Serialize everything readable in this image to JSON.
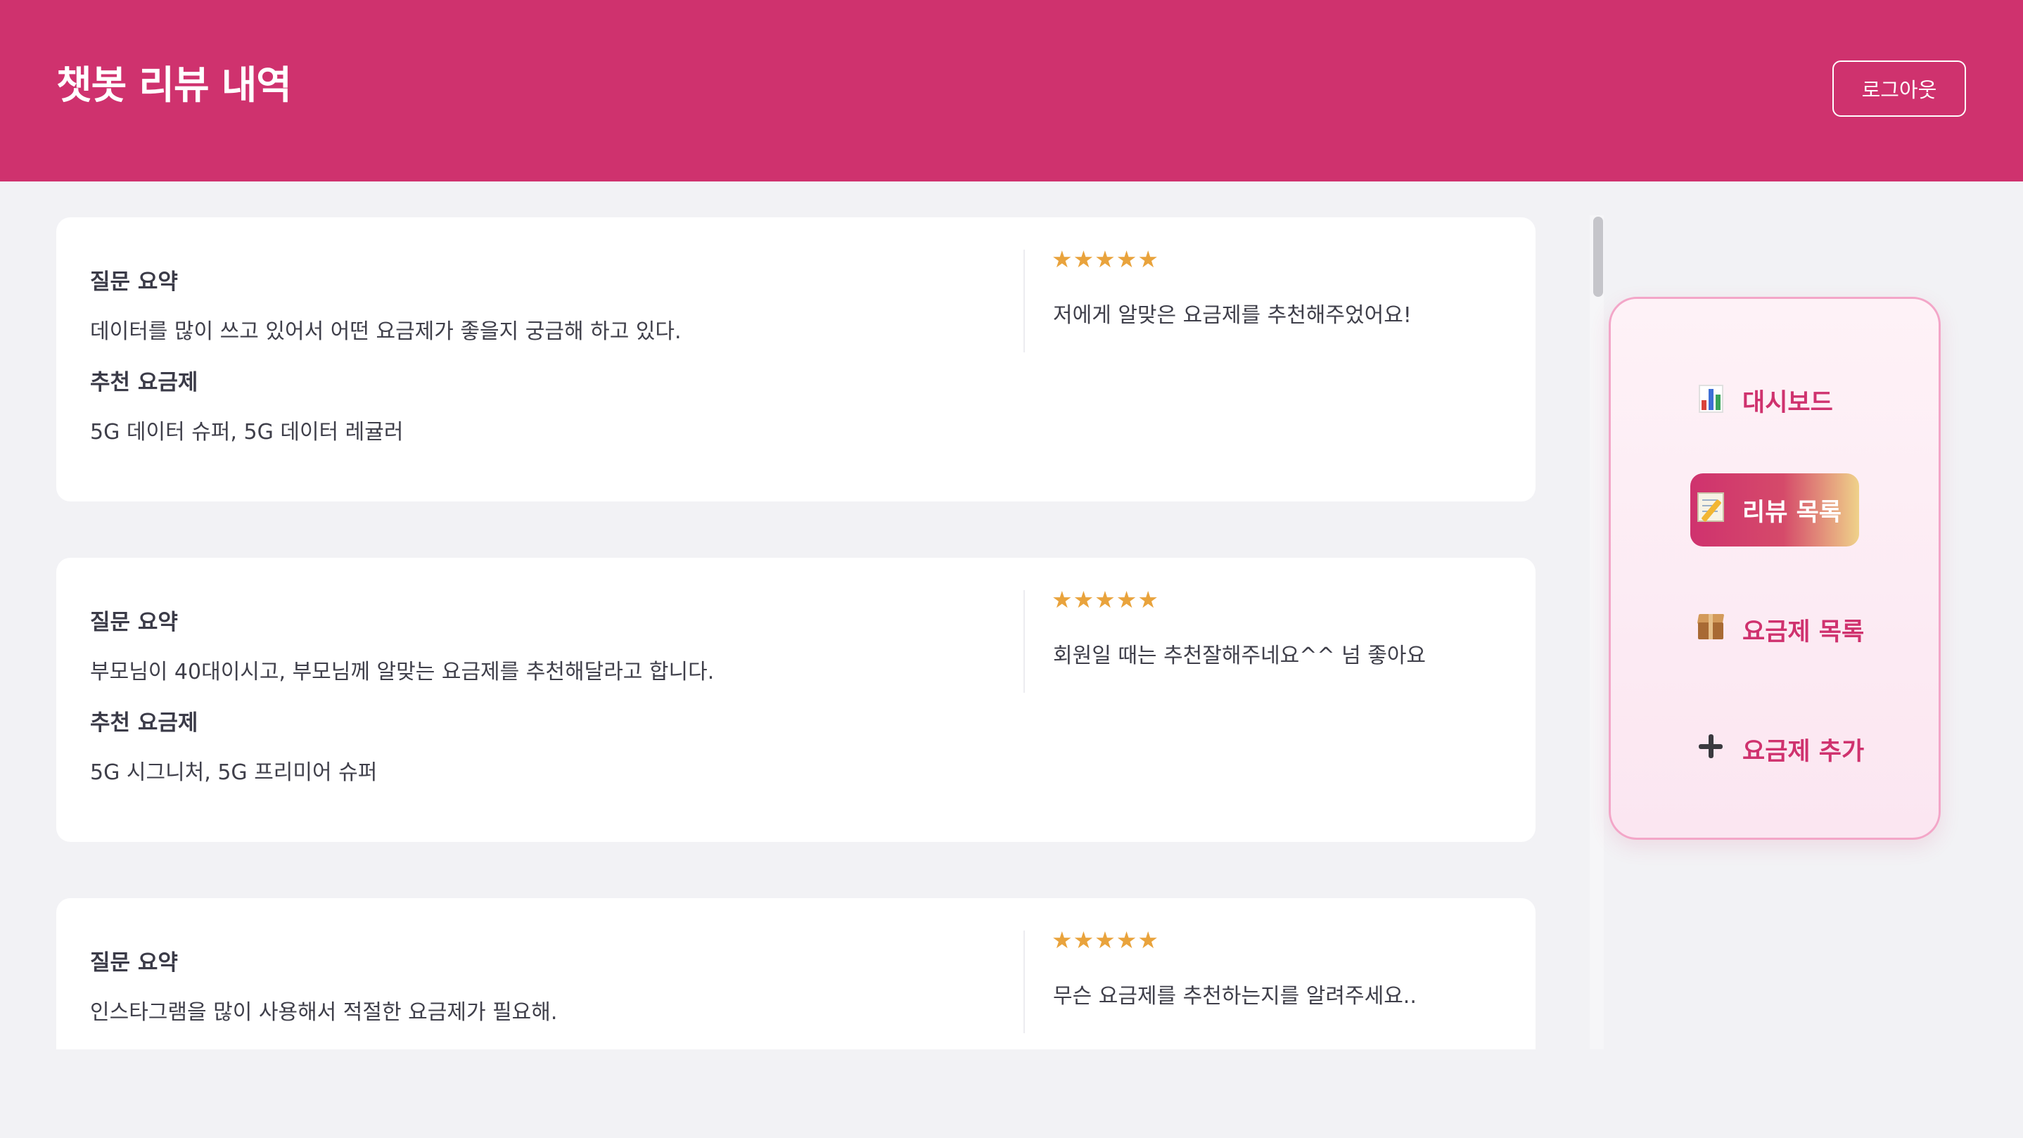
{
  "header": {
    "title": "챗봇 리뷰 내역",
    "logout_label": "로그아웃"
  },
  "labels": {
    "question_summary": "질문 요약",
    "recommended_plan": "추천 요금제"
  },
  "reviews": [
    {
      "question": "데이터를 많이 쓰고 있어서 어떤 요금제가 좋을지 궁금해 하고 있다.",
      "recommended": "5G 데이터 슈퍼, 5G 데이터 레귤러",
      "stars": "★★★★★",
      "rating": 5,
      "comment": "저에게 알맞은 요금제를 추천해주었어요!"
    },
    {
      "question": "부모님이 40대이시고, 부모님께 알맞는 요금제를 추천해달라고 합니다.",
      "recommended": "5G 시그니처, 5G 프리미어 슈퍼",
      "stars": "★★★★★",
      "rating": 5,
      "comment": "회원일 때는 추천잘해주네요^^ 넘 좋아요"
    },
    {
      "question": "인스타그램을 많이 사용해서 적절한 요금제가 필요해.",
      "recommended": "",
      "stars": "★★★★★",
      "rating": 5,
      "comment": "무슨 요금제를 추천하는지를 알려주세요.."
    }
  ],
  "sidebar": {
    "items": [
      {
        "icon": "bar-chart-icon",
        "label": "대시보드",
        "active": false
      },
      {
        "icon": "memo-icon",
        "label": "리뷰 목록",
        "active": true
      },
      {
        "icon": "package-icon",
        "label": "요금제 목록",
        "active": false
      },
      {
        "icon": "plus-icon",
        "label": "요금제 추가",
        "active": false
      }
    ]
  },
  "colors": {
    "brand": "#cf326e",
    "star": "#e9a33c",
    "background": "#f2f2f5"
  }
}
